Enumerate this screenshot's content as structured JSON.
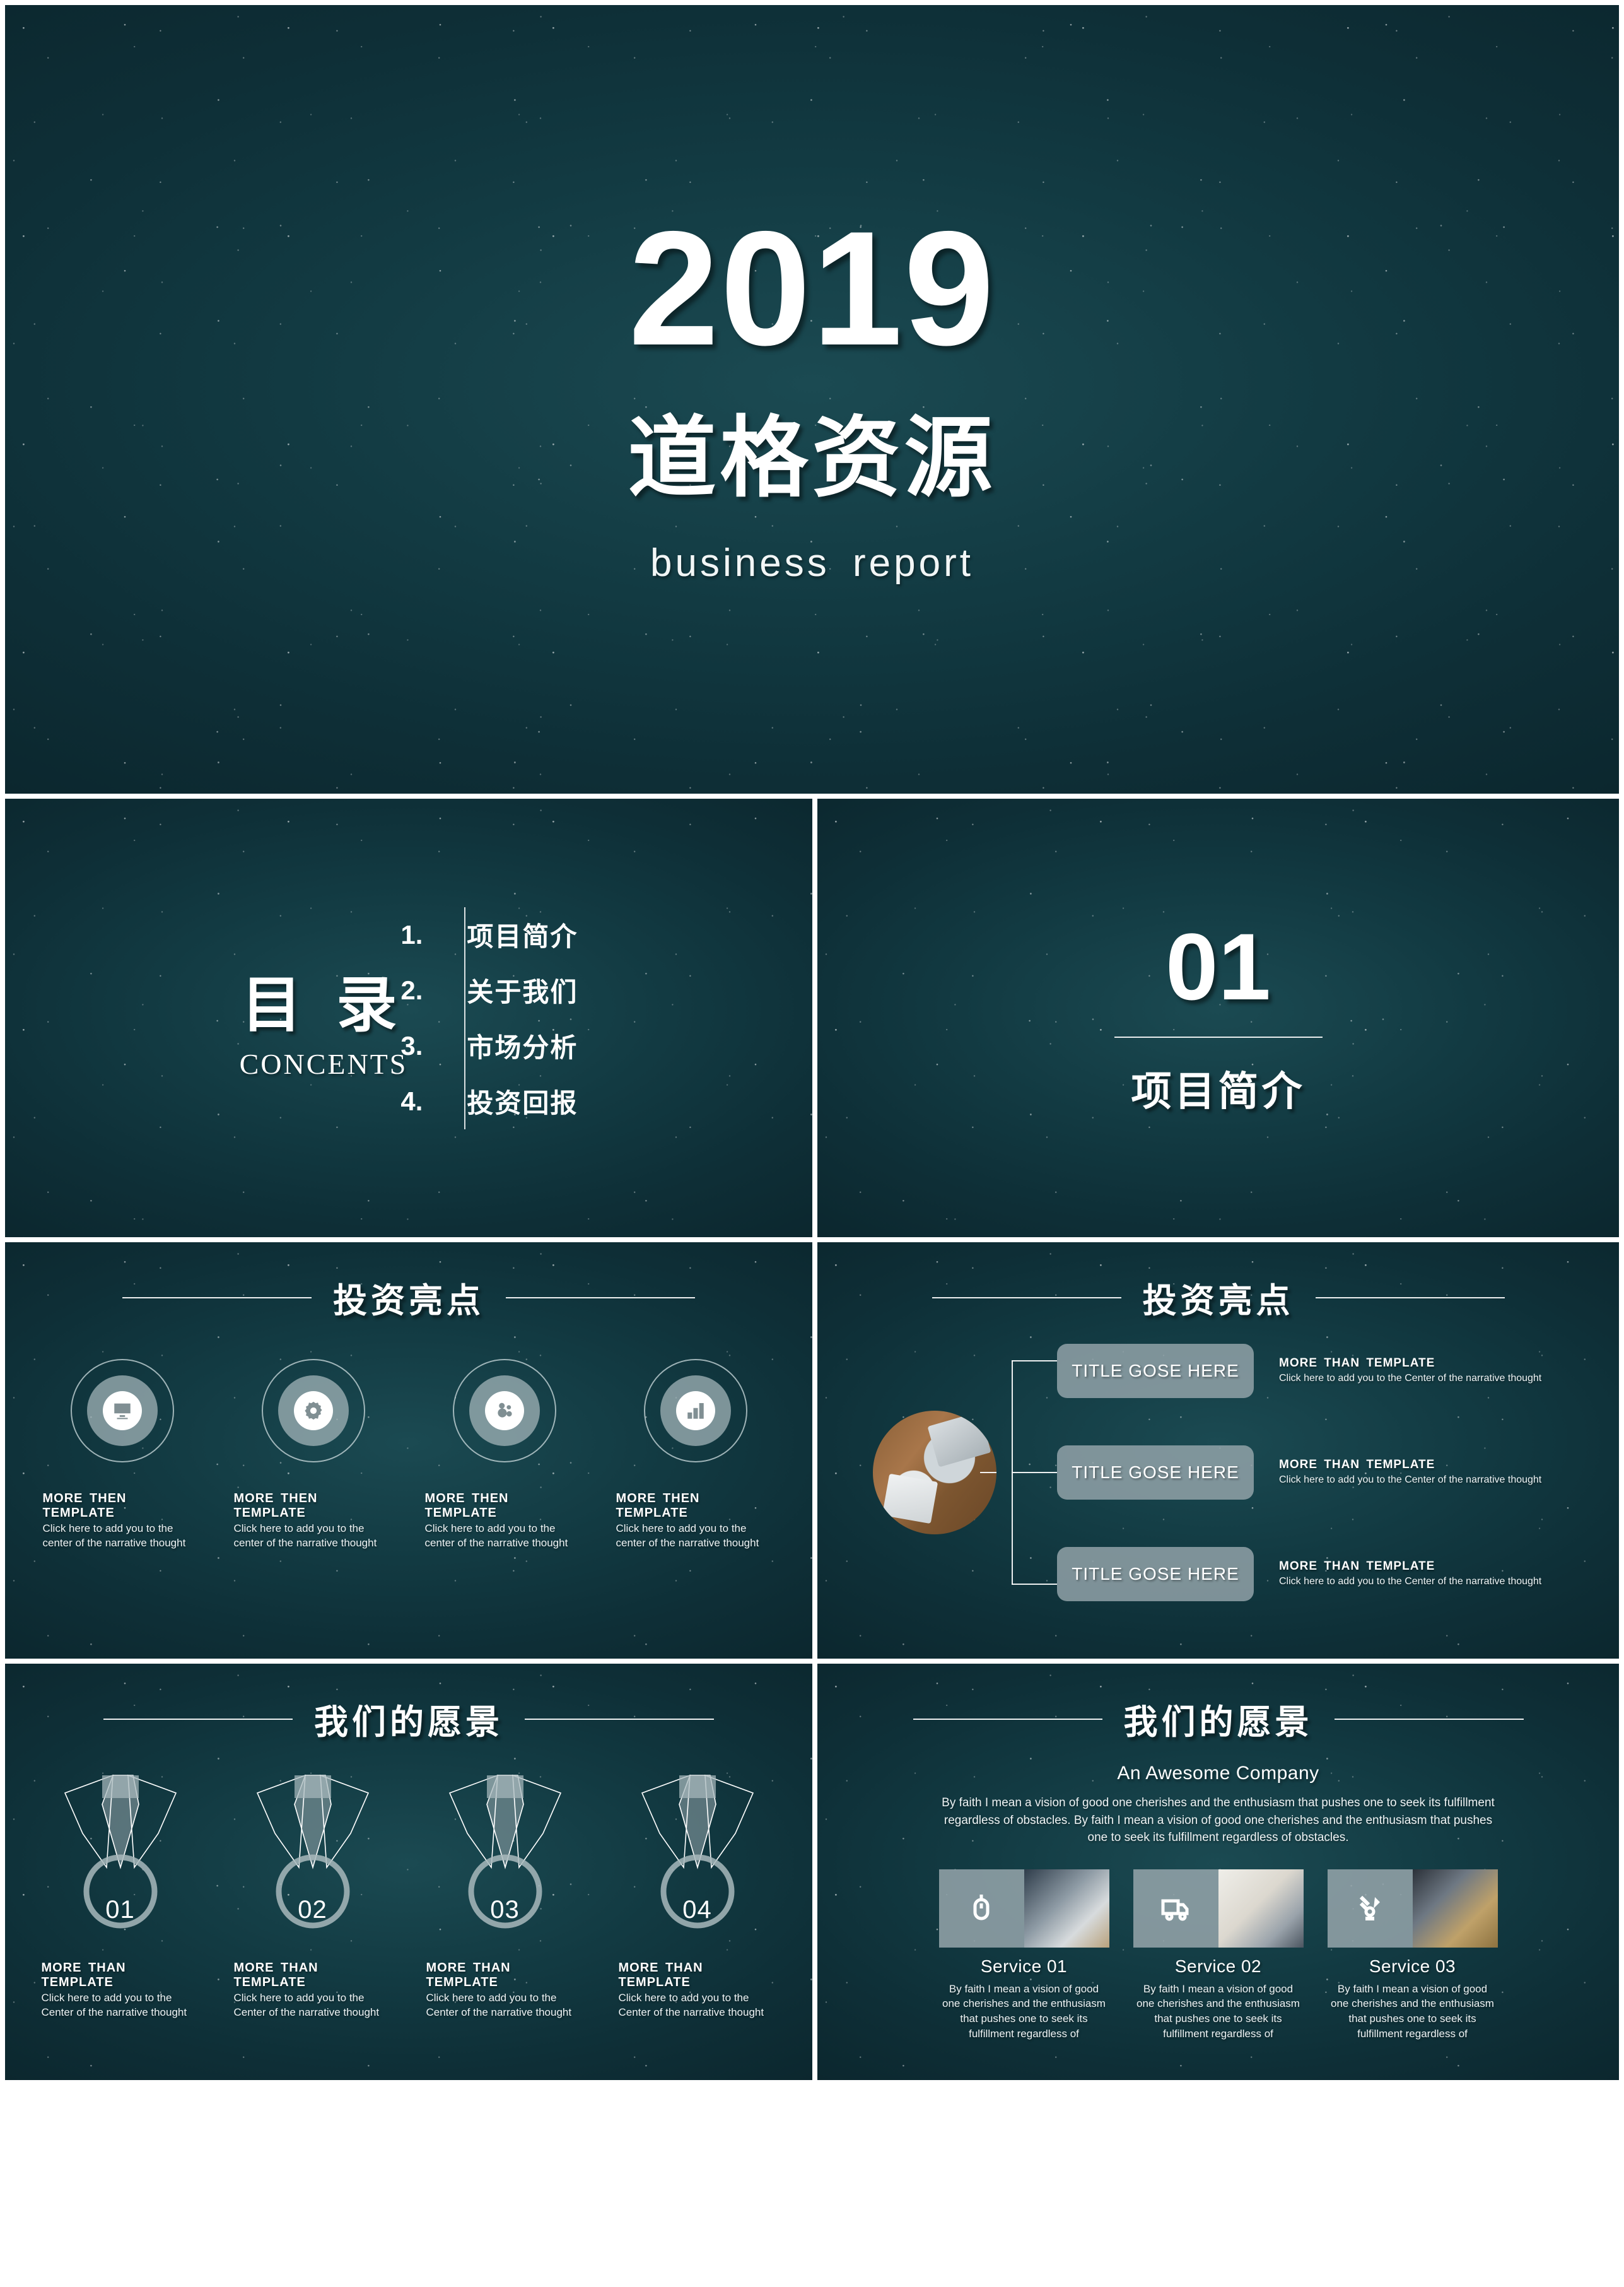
{
  "colors": {
    "background_dark": "#0b242b",
    "background_mid": "#123a42",
    "background_light": "#1b4a52",
    "panel_gray": "#96a6ac",
    "text_white": "#ffffff",
    "gap_white": "#ffffff"
  },
  "title_slide": {
    "year": "2019",
    "company": "道格资源",
    "subtitle": "business  report"
  },
  "toc_slide": {
    "heading_cn": "目 录",
    "heading_en": "CONCENTS",
    "items": [
      {
        "num": "1.",
        "label": "项目简介"
      },
      {
        "num": "2.",
        "label": "关于我们"
      },
      {
        "num": "3.",
        "label": "市场分析"
      },
      {
        "num": "4.",
        "label": "投资回报"
      }
    ]
  },
  "section_slide": {
    "number": "01",
    "label": "项目简介"
  },
  "icons_slide": {
    "header": "投资亮点",
    "items": [
      {
        "icon": "monitor-icon",
        "caption_head": "MORE  THEN  TEMPLATE",
        "caption_body": "Click here to add  you to the  center of the  narrative thought"
      },
      {
        "icon": "gear-icon",
        "caption_head": "MORE  THEN  TEMPLATE",
        "caption_body": "Click here to add  you to the  center of the  narrative thought"
      },
      {
        "icon": "bubbles-icon",
        "caption_head": "MORE  THEN  TEMPLATE",
        "caption_body": "Click here to add  you to the  center of the  narrative thought"
      },
      {
        "icon": "bar-chart-icon",
        "caption_head": "MORE  THEN  TEMPLATE",
        "caption_body": "Click here to add  you to the  center of the  narrative thought"
      }
    ]
  },
  "bars_slide": {
    "header": "投资亮点",
    "photo": "business-handshake-photo",
    "rows": [
      {
        "bar_label": "TITLE GOSE HERE",
        "caption_head": "MORE  THAN  TEMPLATE",
        "caption_body": "Click here to add  you to the Center of the  narrative thought"
      },
      {
        "bar_label": "TITLE GOSE HERE",
        "caption_head": "MORE  THAN  TEMPLATE",
        "caption_body": "Click here to add  you to the Center of the  narrative thought"
      },
      {
        "bar_label": "TITLE GOSE HERE",
        "caption_head": "MORE  THAN  TEMPLATE",
        "caption_body": "Click here to add  you to the Center of the  narrative thought"
      }
    ]
  },
  "medals_slide": {
    "header": "我们的愿景",
    "items": [
      {
        "number": "01",
        "caption_head": "MORE  THAN  TEMPLATE",
        "caption_body": "Click here to add  you to the Center of the  narrative thought"
      },
      {
        "number": "02",
        "caption_head": "MORE  THAN  TEMPLATE",
        "caption_body": "Click here to add  you to the Center of the  narrative thought"
      },
      {
        "number": "03",
        "caption_head": "MORE  THAN  TEMPLATE",
        "caption_body": "Click here to add  you to the Center of the  narrative thought"
      },
      {
        "number": "04",
        "caption_head": "MORE  THAN  TEMPLATE",
        "caption_body": "Click here to add  you to the Center of the  narrative thought"
      }
    ]
  },
  "vision_slide": {
    "header": "我们的愿景",
    "subheading": "An Awesome Company",
    "paragraph": "By faith I mean a vision of good one cherishes and the enthusiasm that pushes one to seek its fulfillment regardless of obstacles. By faith I mean a vision of good one cherishes and the enthusiasm that pushes one to seek its fulfillment regardless of obstacles.",
    "services": [
      {
        "icon": "mouse-icon",
        "name": "Service 01",
        "body": "By faith I mean a vision of good one cherishes and the enthusiasm that pushes one to seek its fulfillment regardless of"
      },
      {
        "icon": "truck-icon",
        "name": "Service 02",
        "body": "By faith I mean a vision of good one cherishes and the enthusiasm that pushes one to seek its fulfillment regardless of"
      },
      {
        "icon": "signal-icon",
        "name": "Service 03",
        "body": "By faith I mean a vision of good one cherishes and the enthusiasm that pushes one to seek its fulfillment regardless of"
      }
    ]
  }
}
